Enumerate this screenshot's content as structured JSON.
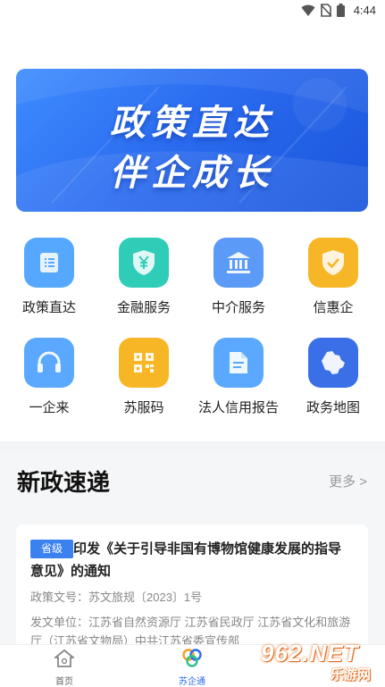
{
  "status": {
    "time": "4:44"
  },
  "banner": {
    "line1": "政策直达",
    "line2": "伴企成长"
  },
  "services": [
    {
      "label": "政策直达",
      "icon": "policy-list-icon",
      "color": "#56a8ff"
    },
    {
      "label": "金融服务",
      "icon": "yuan-shield-icon",
      "color": "#2fcdb8"
    },
    {
      "label": "中介服务",
      "icon": "bank-building-icon",
      "color": "#5b9bf7"
    },
    {
      "label": "信惠企",
      "icon": "check-shield-icon",
      "color": "#f7b626"
    },
    {
      "label": "一企来",
      "icon": "headset-icon",
      "color": "#5aa8ff"
    },
    {
      "label": "苏服码",
      "icon": "qr-code-icon",
      "color": "#f7b626"
    },
    {
      "label": "法人信用报告",
      "icon": "document-icon",
      "color": "#5aa8ff"
    },
    {
      "label": "政务地图",
      "icon": "jiangsu-map-icon",
      "color": "#3a6fe8"
    }
  ],
  "news": {
    "title": "新政速递",
    "more": "更多 >",
    "card": {
      "tag": "省级",
      "title": "印发《关于引导非国有博物馆健康发展的指导意见》的通知",
      "doc_no": "政策文号：苏文旅规〔2023〕1号",
      "issuer": "发文单位：江苏省自然资源厅 江苏省民政厅 江苏省文化和旅游厅（江苏省文物局）中共江苏省委宣传部"
    }
  },
  "tabs": [
    {
      "label": "首页",
      "icon": "home-icon"
    },
    {
      "label": "苏企通",
      "icon": "su-qi-tong-logo-icon"
    }
  ],
  "watermark": {
    "big": "962.NET",
    "small": "乐游网"
  }
}
